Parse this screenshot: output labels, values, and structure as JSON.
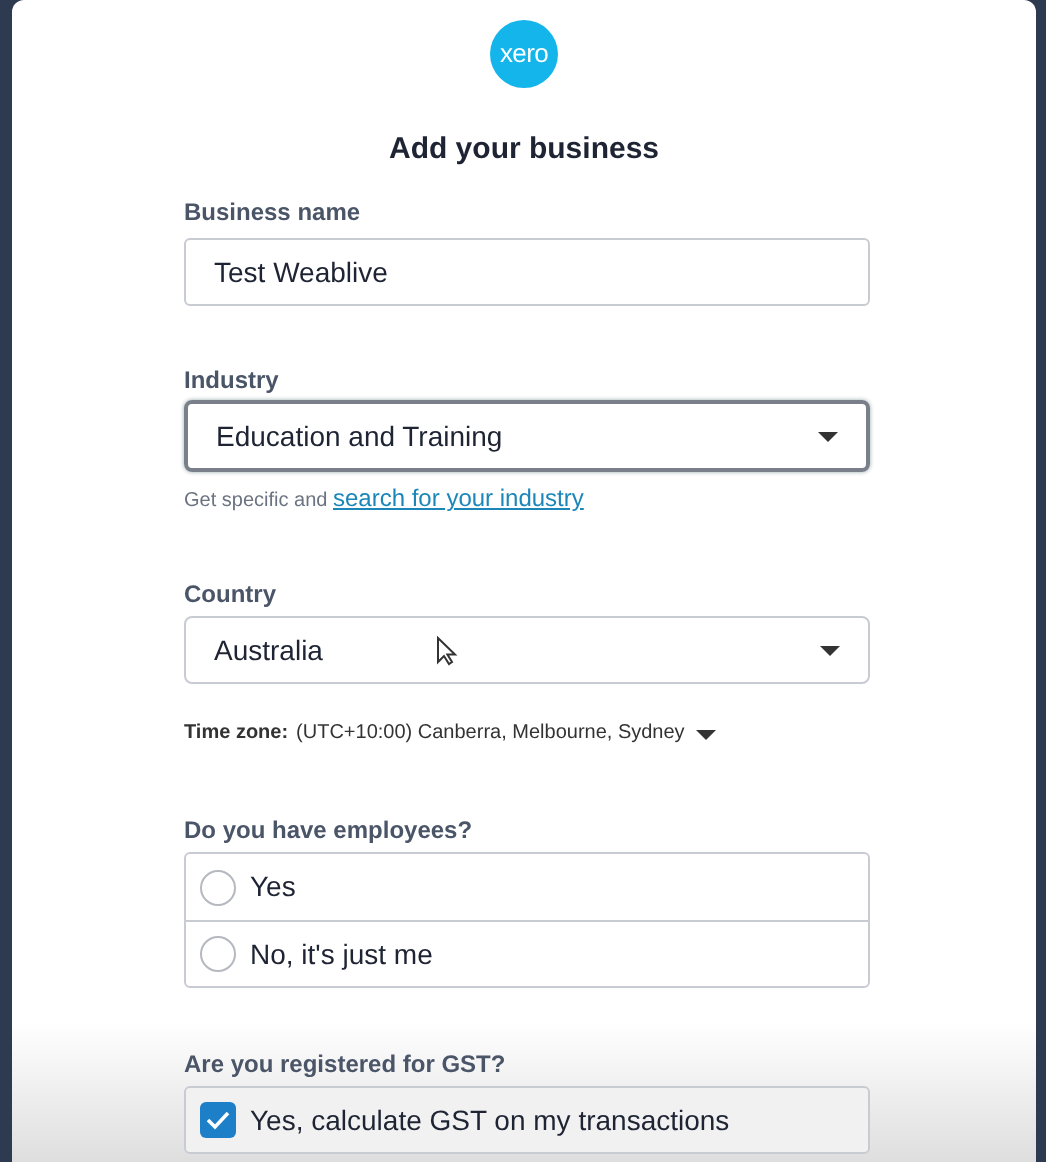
{
  "logo": {
    "text": "xero"
  },
  "title": "Add your business",
  "business_name": {
    "label": "Business name",
    "value": "Test Weablive"
  },
  "industry": {
    "label": "Industry",
    "value": "Education and Training",
    "focused": true,
    "help": "Get specific and",
    "help_link": "search for your industry"
  },
  "country": {
    "label": "Country",
    "value": "Australia",
    "focused": false
  },
  "time_zone": {
    "label": "Time zone:",
    "value": "(UTC+10:00) Canberra, Melbourne, Sydney"
  },
  "employees": {
    "label": "Do you have employees?",
    "options": [
      {
        "label": "Yes",
        "selected": false
      },
      {
        "label": "No, it's just me",
        "selected": false
      }
    ]
  },
  "gst": {
    "label": "Are you registered for GST?",
    "option": {
      "label": "Yes, calculate GST on my transactions",
      "checked": true
    }
  }
}
